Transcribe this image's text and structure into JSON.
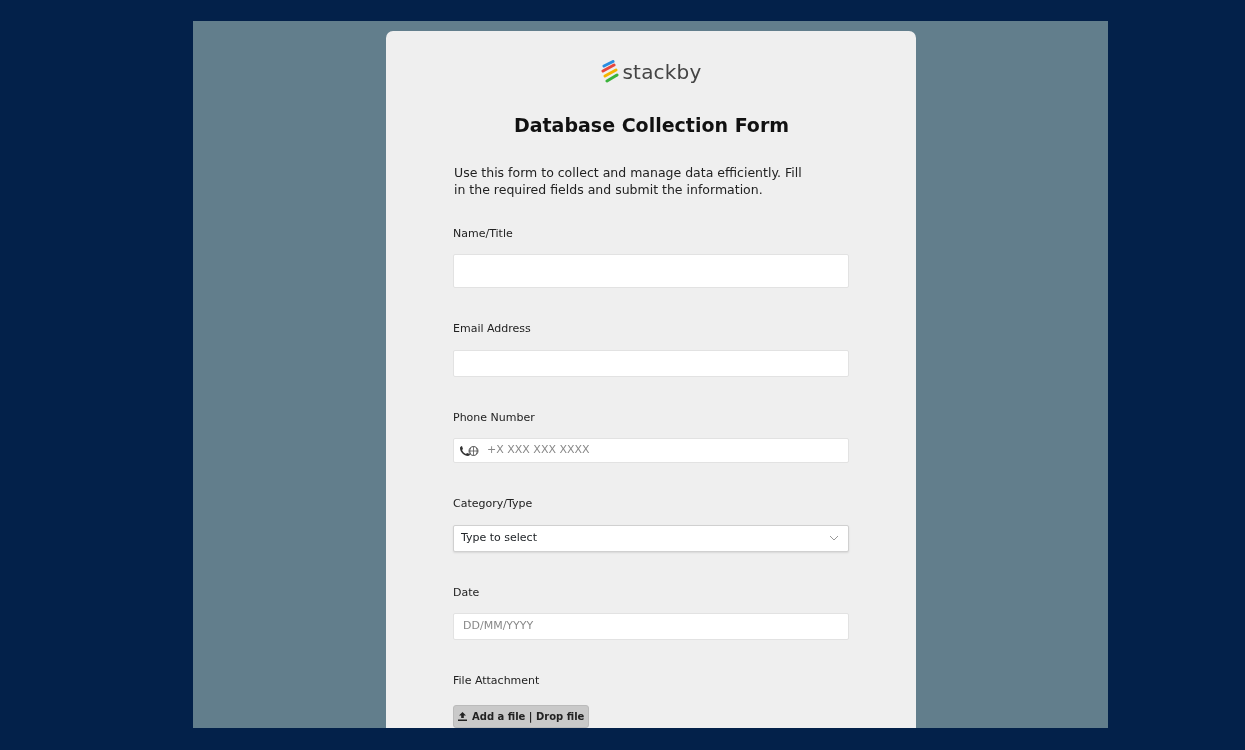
{
  "logo": {
    "text": "stackby"
  },
  "form": {
    "title": "Database Collection Form",
    "description": "Use this form to collect and manage data efficiently. Fill in the required fields and submit the information."
  },
  "fields": [
    {
      "kind": "text",
      "label": "Name/Title"
    },
    {
      "kind": "text",
      "label": "Email Address"
    },
    {
      "kind": "phone",
      "label": "Phone Number",
      "placeholder": "+X XXX XXX XXXX"
    },
    {
      "kind": "select",
      "label": "Category/Type",
      "placeholder": "Type to select"
    },
    {
      "kind": "date",
      "label": "Date",
      "placeholder": "DD/MM/YYYY"
    },
    {
      "kind": "file",
      "label": "File Attachment",
      "button": "Add a file | Drop file"
    }
  ]
}
